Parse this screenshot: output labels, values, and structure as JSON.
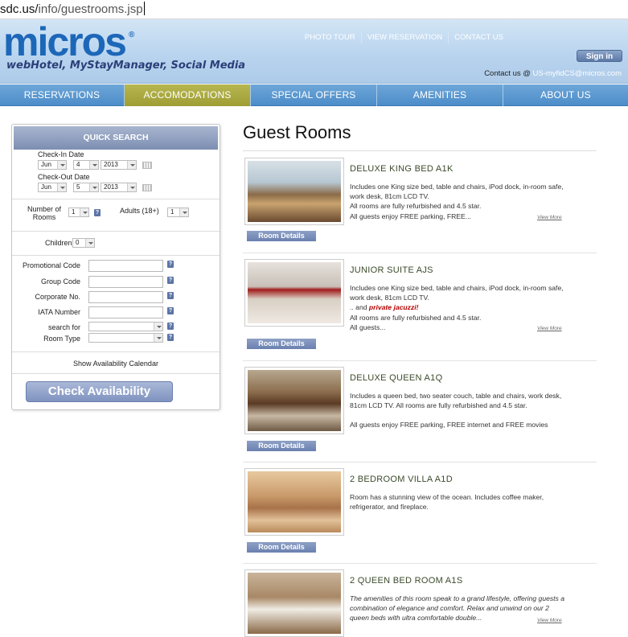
{
  "browser": {
    "url_domain": "sdc.us/",
    "url_path": "info/guestrooms.jsp"
  },
  "header": {
    "logo_text": "micros",
    "logo_reg": "®",
    "tagline": "webHotel, MyStayManager, Social Media",
    "top_links": [
      "PHOTO TOUR",
      "VIEW RESERVATION",
      "CONTACT US"
    ],
    "signin_label": "Sign in",
    "contact_prefix": "Contact us @",
    "contact_email": "US-myfidCS@micros.com"
  },
  "nav": {
    "items": [
      "RESERVATIONS",
      "ACCOMODATIONS",
      "SPECIAL OFFERS",
      "AMENITIES",
      "ABOUT US"
    ],
    "active": "ACCOMODATIONS"
  },
  "quick_search": {
    "title": "QUICK SEARCH",
    "checkin_label": "Check-In Date",
    "checkin": {
      "month": "Jun",
      "day": "4",
      "year": "2013"
    },
    "checkout_label": "Check-Out Date",
    "checkout": {
      "month": "Jun",
      "day": "5",
      "year": "2013"
    },
    "rooms_label_1": "Number of",
    "rooms_label_2": "Rooms",
    "rooms_value": "1",
    "adults_label": "Adults (18+)",
    "adults_value": "1",
    "children_label": "Children",
    "children_value": "0",
    "promo_label": "Promotional Code",
    "group_label": "Group Code",
    "corporate_label": "Corporate No.",
    "iata_label": "IATA Number",
    "searchfor_label": "search for",
    "roomtype_label": "Room Type",
    "help_glyph": "?",
    "calendar_link": "Show Availability Calendar",
    "check_button": "Check Availability"
  },
  "guest_rooms": {
    "title": "Guest Rooms",
    "details_label": "Room Details",
    "view_more": "View More",
    "rooms": [
      {
        "name": "DELUXE KING BED A1K",
        "desc": [
          "Includes one King size bed, table and chairs, iPod dock, in-room safe, work desk, 81cm LCD TV.",
          "All rooms are fully refurbished and 4.5 star.",
          "All guests enjoy FREE parking, FREE..."
        ]
      },
      {
        "name": "JUNIOR SUITE AJS",
        "desc": [
          "Includes one King size bed, table and chairs, iPod dock, in-room safe, work desk, 81cm LCD TV.",
          "All rooms are fully refurbished and 4.5 star.",
          "All guests..."
        ],
        "desc_prefix": ".. and ",
        "highlight": "private jacuzzi!"
      },
      {
        "name": "DELUXE QUEEN A1Q",
        "desc": [
          "Includes a queen bed, two seater couch, table and chairs, work desk, 81cm LCD TV.  All rooms are fully refurbished and 4.5 star.",
          "All guests enjoy FREE parking, FREE internet and FREE movies"
        ]
      },
      {
        "name": "2 BEDROOM VILLA A1D",
        "desc": [
          "Room has a stunning view of the ocean. Includes coffee maker, refrigerator, and fireplace."
        ]
      },
      {
        "name": "2 QUEEN BED ROOM A1S",
        "desc": [
          "The amenities of this room speak to a grand lifestyle, offering guests a combination of elegance and comfort. Relax and unwind on our 2 queen beds with ultra comfortable double..."
        ]
      }
    ]
  }
}
